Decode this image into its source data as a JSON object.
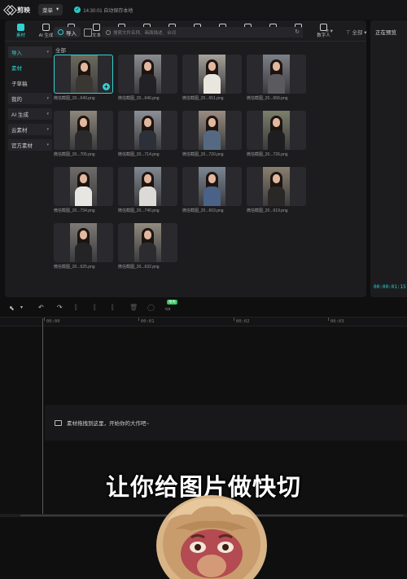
{
  "app": {
    "logo_text": "剪映",
    "menu_label": "菜单",
    "save_status": "14:30:01 自动保存本地"
  },
  "toolbar": {
    "tabs": [
      {
        "label": "素材",
        "icon": "media-icon",
        "active": true
      },
      {
        "label": "AI 生成",
        "icon": "ai-icon"
      },
      {
        "label": "音频",
        "icon": "audio-icon"
      },
      {
        "label": "文本",
        "icon": "text-icon"
      },
      {
        "label": "贴纸",
        "icon": "sticker-icon"
      },
      {
        "label": "特效",
        "icon": "effects-icon"
      },
      {
        "label": "转场",
        "icon": "transition-icon"
      },
      {
        "label": "字幕",
        "icon": "subtitle-icon"
      },
      {
        "label": "智能包装",
        "icon": "smart-pack-icon"
      },
      {
        "label": "滤镜",
        "icon": "filter-icon"
      },
      {
        "label": "调节",
        "icon": "adjust-icon"
      },
      {
        "label": "模板",
        "icon": "template-icon"
      },
      {
        "label": "数字人",
        "icon": "digital-human-icon"
      }
    ]
  },
  "sidebar": {
    "items": [
      {
        "label": "导入",
        "caret": "▾",
        "state": "active"
      },
      {
        "label": "素材",
        "caret": "",
        "state": "sub-active"
      },
      {
        "label": "子草稿",
        "caret": "",
        "state": ""
      },
      {
        "label": "我的",
        "caret": "▾",
        "state": "boxed"
      },
      {
        "label": "AI 生成",
        "caret": "▾",
        "state": "boxed"
      },
      {
        "label": "云素材",
        "caret": "▾",
        "state": "boxed"
      },
      {
        "label": "官方素材",
        "caret": "▾",
        "state": "boxed"
      }
    ]
  },
  "media": {
    "import_label": "导入",
    "search_placeholder": "搜索文件名称、画面描述、台词",
    "sort_label": "≡ ▾",
    "filter_label": "⊤ 全部 ▾",
    "all_label": "全部",
    "items": [
      {
        "name": "微信截图_20...640.png",
        "bg": "#6b6a5c",
        "top": "#3a3632",
        "selected": true
      },
      {
        "name": "微信截图_20...646.png",
        "bg": "#8a8d90",
        "top": "#222226"
      },
      {
        "name": "微信截图_20...651.png",
        "bg": "#a7a39a",
        "top": "#e9e6e0"
      },
      {
        "name": "微信截图_20...656.png",
        "bg": "#7d8088",
        "top": "#5a5a60"
      },
      {
        "name": "微信截图_20...705.png",
        "bg": "#8d867c",
        "top": "#2a2a2c"
      },
      {
        "name": "微信截图_20...714.png",
        "bg": "#8c8f96",
        "top": "#2c3038"
      },
      {
        "name": "微信截图_20...720.png",
        "bg": "#9a8c82",
        "top": "#556a82"
      },
      {
        "name": "微信截图_20...726.png",
        "bg": "#7b7f6a",
        "top": "#1e1e20"
      },
      {
        "name": "微信截图_20...734.png",
        "bg": "#6f6c6a",
        "top": "#e8e6e2"
      },
      {
        "name": "微信截图_20...740.png",
        "bg": "#808892",
        "top": "#dcdad6"
      },
      {
        "name": "微信截图_20...603.png",
        "bg": "#7c8694",
        "top": "#4a6288"
      },
      {
        "name": "微信截图_20...619.png",
        "bg": "#8a7e6e",
        "top": "#2a2826"
      },
      {
        "name": "微信截图_20...625.png",
        "bg": "#7d7a76",
        "top": "#242426"
      },
      {
        "name": "微信截图_20...632.png",
        "bg": "#918b80",
        "top": "#2c2c30"
      }
    ]
  },
  "preview": {
    "title": "正在预览",
    "timecode": "00:00:01:15"
  },
  "timeline": {
    "badge": "限免",
    "ticks": [
      "00:00",
      "00:01",
      "00:02",
      "00:03"
    ],
    "drop_hint": "素材拖拽到这里，开始你的大作吧~"
  },
  "overlay": {
    "caption": "让你给图片做快切"
  }
}
